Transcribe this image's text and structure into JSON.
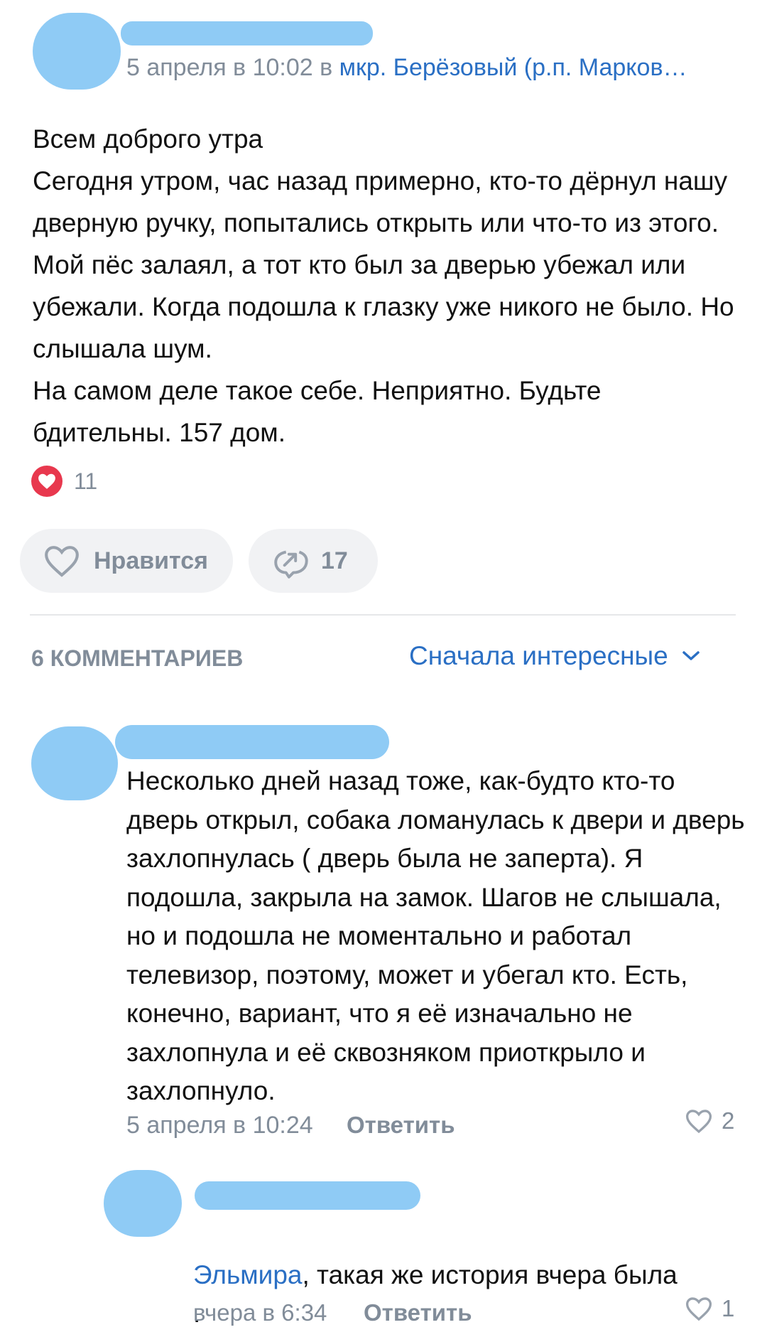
{
  "post": {
    "meta_date": "5 апреля в 10:02",
    "meta_in": "в",
    "location": "мкр. Берёзовый (р.п. Марков…",
    "text": "Всем доброго утра\nСегодня утром, час назад примерно, кто-то дёрнул нашу дверную ручку, попытались открыть или что-то из этого. Мой пёс залаял, а тот кто был за дверью убежал или убежали. Когда подошла к глазку уже никого не было. Но слышала шум.\nНа самом деле такое себе. Неприятно. Будьте бдительны. 157 дом.",
    "reactions_count": "11",
    "like_label": "Нравится",
    "share_count": "17"
  },
  "comments_header": {
    "count_label": "6 КОММЕНТАРИЕВ",
    "sort_label": "Сначала интересные"
  },
  "comments": [
    {
      "text": "Несколько дней назад тоже, как-будто кто-то дверь открыл, собака ломанулась к двери и дверь захлопнулась ( дверь была не заперта). Я подошла, закрыла на замок. Шагов не слышала, но и подошла не моментально и работал телевизор, поэтому, может и убегал кто. Есть, конечно, вариант, что я её изначально не захлопнула и её сквозняком приоткрыло и захлопнуло.",
      "date": "5 апреля в 10:24",
      "reply_label": "Ответить",
      "likes": "2"
    },
    {
      "mention": "Эльмира",
      "text": ", такая же история вчера была .",
      "date": "вчера в 6:34",
      "reply_label": "Ответить",
      "likes": "1"
    }
  ],
  "colors": {
    "accent": "#2a6fc4",
    "reaction_red": "#e8384e",
    "redaction": "#8fcbf5",
    "muted": "#818c99"
  }
}
